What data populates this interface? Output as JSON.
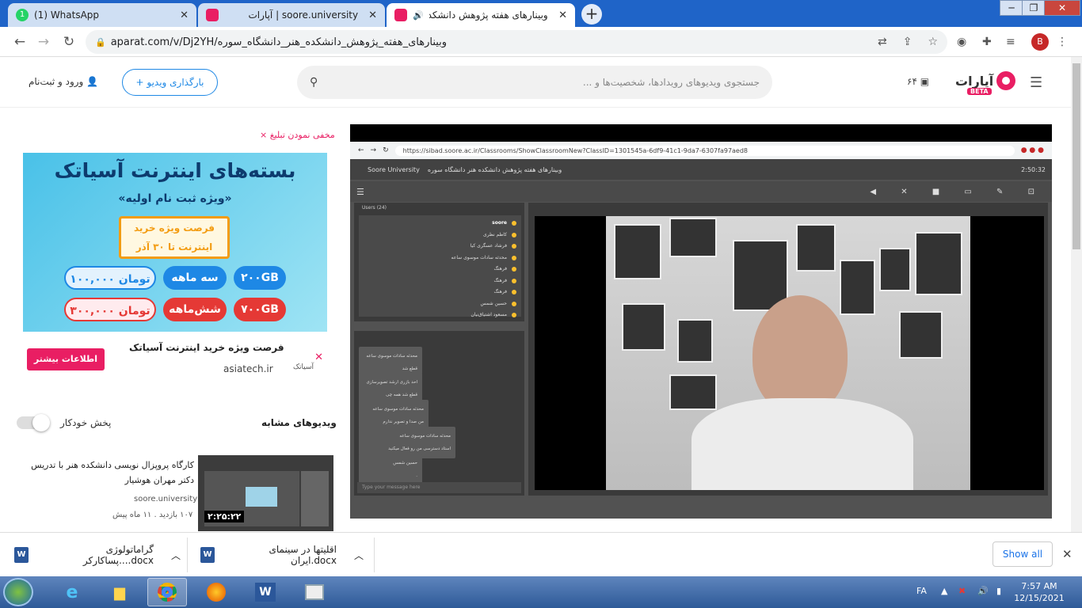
{
  "browser": {
    "tabs": [
      {
        "title": "(1) WhatsApp",
        "icon": "whatsapp-icon"
      },
      {
        "title": "آپارات | soore.university",
        "icon": "aparat-icon"
      },
      {
        "title": "وبینارهای هفته پژوهش دانشکده هنر د",
        "icon": "aparat-icon",
        "active": true
      }
    ],
    "url": "aparat.com/v/Dj2YH/وبینارهای_هفته_پژوهش_دانشکده_هنر_دانشگاه_سوره",
    "profile_initial": "B"
  },
  "header": {
    "search_placeholder": "جستجوی ویدیوهای رویدادها، شخصیت‌ها و ...",
    "upload_label": "+ بارگذاری ویدیو",
    "login_label": "ورود و ثبت‌نام",
    "counter": "۶۴",
    "logo_text": "آپارات",
    "beta_label": "BETA"
  },
  "ad": {
    "hide_label": "× مخفی نمودن تبلیغ",
    "headline": "بسته‌های اینترنت آسیاتک",
    "subline": "«ویژه ثبت نام اولیه»",
    "box_line1": "فرصت ویژه خرید",
    "box_line2": "اینترنت تا ۳۰ آذر",
    "plan1_gb": "۲۰۰GB",
    "plan1_period": "سه ماهه",
    "plan1_price": "۱۰۰,۰۰۰ تومان",
    "plan2_gb": "۷۰۰GB",
    "plan2_period": "شش‌ماهه",
    "plan2_price": "۳۰۰,۰۰۰ تومان",
    "caption": "فرصت ویژه خرید اینترنت آسیاتک",
    "domain": "asiatech.ir",
    "more_button": "اطلاعات بیشتر",
    "advertiser_logo": "آسیاتک"
  },
  "related": {
    "heading": "ویدیوهای مشابه",
    "autoplay_label": "پخش خودکار",
    "items": [
      {
        "title": "کارگاه پروپزال نویسی دانشکده هنر با تدریس دکتر مهران هوشیار",
        "channel": "soore.university",
        "meta": "۱۰۷ بازدید . ۱۱ ماه پیش",
        "duration": "۲:۲۵:۲۲"
      }
    ]
  },
  "player": {
    "inner_url": "https://sibad.soore.ac.ir/Classrooms/ShowClassroomNew?ClassID=1301545a-6df9-41c1-9da7-6307fa97aed8",
    "inner_app_title": "وبینارهای هفته پژوهش دانشکده هنر دانشگاه سوره",
    "inner_app_brand": "Soore University",
    "inner_timer": "2:50:32",
    "users_header": "Users (24)",
    "users": [
      "soore",
      "کاظم نظری",
      "فرشاد عسگری کیا",
      "محدثه سادات موسوی ساعه",
      "فرهنگ",
      "فرهنگ",
      "فرهنگ",
      "حسین شمس",
      "مسعود اشتیاق‌نیان"
    ],
    "messages": [
      {
        "author": "محدثه سادات موسوی ساعه",
        "text": "قطع شد"
      },
      {
        "author": "احد بازری ارشد تصویرسازی",
        "text": "قطع شد همه چی"
      },
      {
        "author": "محدثه سادات موسوی ساعه",
        "text": "من صدا و تصویر ندارم"
      },
      {
        "author": "محدثه سادات موسوی ساعه",
        "text": "استاد دسترسی من رو فعال میکنید"
      },
      {
        "author": "حسین شمس",
        "text": "."
      }
    ],
    "chat_placeholder": "Type your message here"
  },
  "downloads": {
    "items": [
      {
        "name": "گراماتولوژی پساکارکر....docx"
      },
      {
        "name": "اقلیتها در سینمای ایران.docx"
      }
    ],
    "show_all": "Show all"
  },
  "taskbar": {
    "lang": "FA",
    "time": "7:57 AM",
    "date": "12/15/2021"
  },
  "colors": {
    "brand": "#e91e63",
    "link": "#1e88e5",
    "tabstrip": "#1f64c8"
  }
}
